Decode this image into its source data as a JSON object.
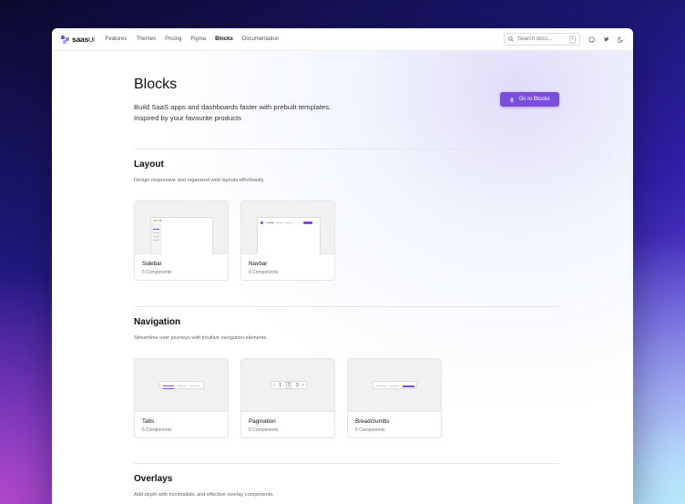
{
  "brand": {
    "name": "saas",
    "suffix": "UI",
    "accent": "#7c4ddb"
  },
  "nav": [
    {
      "label": "Features",
      "active": false
    },
    {
      "label": "Themes",
      "active": false
    },
    {
      "label": "Pricing",
      "active": false
    },
    {
      "label": "Figma",
      "active": false
    },
    {
      "label": "Blocks",
      "active": true
    },
    {
      "label": "Documentation",
      "active": false
    }
  ],
  "search": {
    "placeholder": "Search docs...",
    "shortcut": "/"
  },
  "topbar_icons": [
    "github-icon",
    "twitter-icon",
    "moon-icon"
  ],
  "hero": {
    "title": "Blocks",
    "subtitle_line1": "Build SaaS apps and dashboards faster with prebuilt templates.",
    "subtitle_line2": "Inspired by your favourite products",
    "cta_label": "Go to Blocks"
  },
  "sections": [
    {
      "title": "Layout",
      "description": "Design responsive and organized web layouts effortlessly.",
      "cards": [
        {
          "name": "Sidebar",
          "count": "6 Components"
        },
        {
          "name": "Navbar",
          "count": "6 Components"
        }
      ]
    },
    {
      "title": "Navigation",
      "description": "Streamline user journeys with intuitive navigation elements.",
      "cards": [
        {
          "name": "Tabs",
          "count": "6 Components"
        },
        {
          "name": "Pagination",
          "count": "6 Components"
        },
        {
          "name": "Breadcrumbs",
          "count": "6 Components"
        }
      ]
    },
    {
      "title": "Overlays",
      "description": "Add depth with minimalistic and effective overlay components.",
      "cards": []
    }
  ],
  "pagination_preview": {
    "prev": "‹",
    "pages": [
      "1",
      "2",
      "3"
    ],
    "next": "›"
  }
}
